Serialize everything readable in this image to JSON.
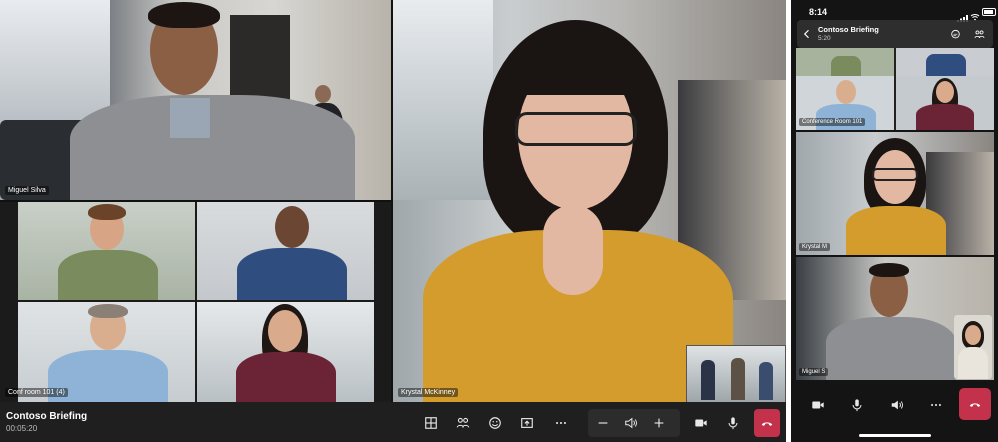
{
  "desktop": {
    "participants": {
      "main_left": "Miguel Silva",
      "room": "Conf room 101 (4)",
      "main_right": "Krystal McKinney"
    },
    "meeting": {
      "title": "Contoso Briefing",
      "duration": "00:05:20"
    },
    "controls": [
      "grid-icon",
      "people-icon",
      "reactions-icon",
      "share-icon",
      "more-icon",
      "minus-icon",
      "volume-icon",
      "plus-icon",
      "camera-icon",
      "mic-icon",
      "hangup-icon"
    ],
    "colors": {
      "hangup": "#c4314b",
      "bar": "#1f1f1f"
    }
  },
  "mobile": {
    "status": {
      "time": "8:14"
    },
    "meeting": {
      "title": "Contoso Briefing",
      "duration": "5:20"
    },
    "participants": {
      "room": "Conference Room 101",
      "krystal": "Krystal M",
      "miguel": "Miguel S"
    },
    "controls": [
      "camera-icon",
      "mic-icon",
      "speaker-icon",
      "more-icon",
      "hangup-icon"
    ]
  }
}
